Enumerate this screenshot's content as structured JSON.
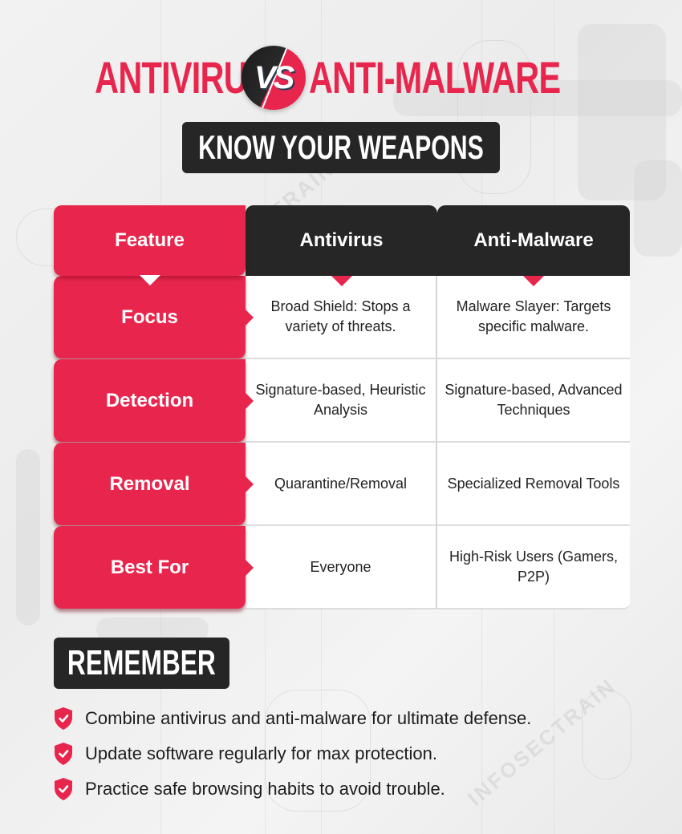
{
  "colors": {
    "accent": "#e8264d",
    "dark": "#262626",
    "cell_bg": "#ffffff",
    "text": "#222222"
  },
  "title": {
    "left": "ANTIVIRUS",
    "vs": "VS",
    "right": "ANTI-MALWARE"
  },
  "subtitle": "KNOW YOUR WEAPONS",
  "table": {
    "headers": [
      "Feature",
      "Antivirus",
      "Anti-Malware"
    ],
    "rows": [
      {
        "feature": "Focus",
        "antivirus": "Broad Shield: Stops a variety of threats.",
        "antimalware": "Malware Slayer: Targets specific malware."
      },
      {
        "feature": "Detection",
        "antivirus": "Signature-based, Heuristic Analysis",
        "antimalware": "Signature-based, Advanced Techniques"
      },
      {
        "feature": "Removal",
        "antivirus": "Quarantine/Removal",
        "antimalware": "Specialized Removal Tools"
      },
      {
        "feature": "Best For",
        "antivirus": "Everyone",
        "antimalware": "High-Risk Users (Gamers, P2P)"
      }
    ]
  },
  "remember": {
    "heading": "REMEMBER",
    "icon": "shield-check-icon",
    "items": [
      "Combine antivirus and anti-malware for ultimate defense.",
      "Update software regularly for max protection.",
      "Practice safe browsing habits to avoid trouble."
    ]
  },
  "watermark": "INFOSECTRAIN"
}
